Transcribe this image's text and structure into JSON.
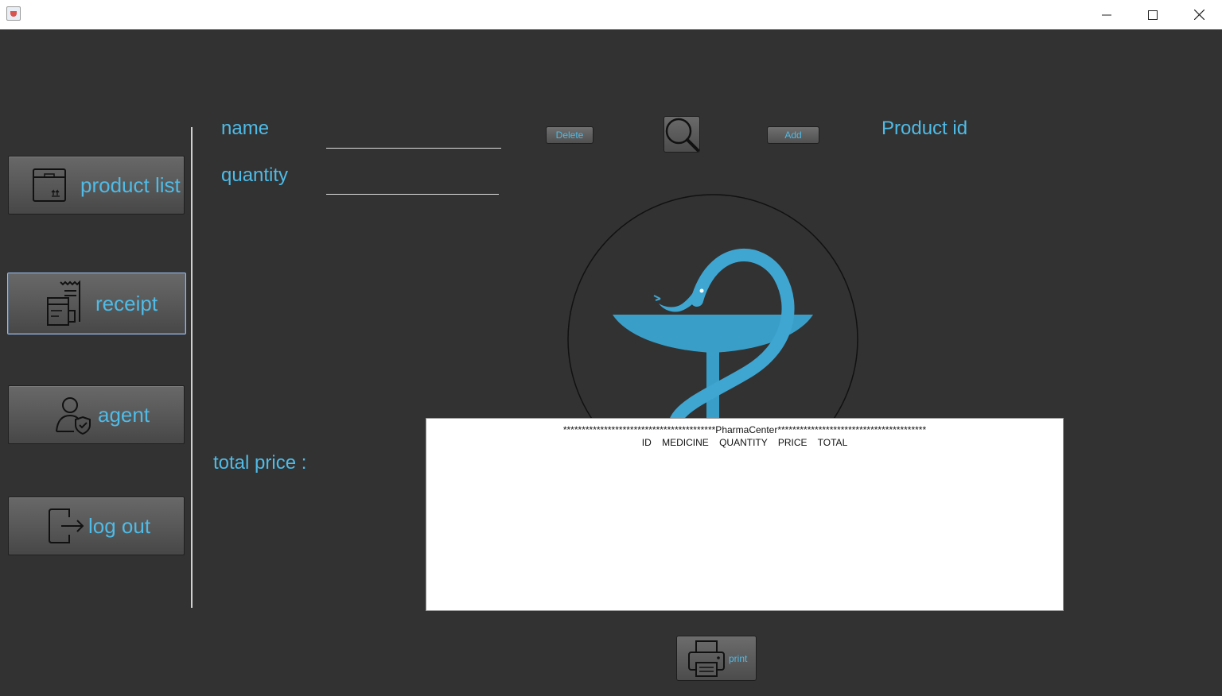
{
  "window": {
    "app_icon": "java-cup-icon",
    "controls": [
      "minimize",
      "maximize",
      "close"
    ]
  },
  "sidebar": {
    "items": [
      {
        "label": "product list",
        "icon": "box-icon"
      },
      {
        "label": "receipt",
        "icon": "receipt-icon",
        "selected": true
      },
      {
        "label": "agent",
        "icon": "agent-shield-icon"
      },
      {
        "label": "log out",
        "icon": "logout-icon"
      }
    ]
  },
  "form": {
    "name_label": "name",
    "name_value": "",
    "quantity_label": "quantity",
    "quantity_value": "",
    "product_id_label": "Product id",
    "total_price_label": "total price :"
  },
  "actions": {
    "delete_label": "Delete",
    "search_icon": "search-icon",
    "add_label": "Add",
    "print_label": "print",
    "print_icon": "printer-icon"
  },
  "receipt": {
    "header": "*****************************************PharmaCenter****************************************",
    "columns": "ID    MEDICINE    QUANTITY    PRICE    TOTAL"
  },
  "colors": {
    "background": "#323232",
    "accent": "#4fbbe6",
    "logo": "#3a9fc8"
  }
}
